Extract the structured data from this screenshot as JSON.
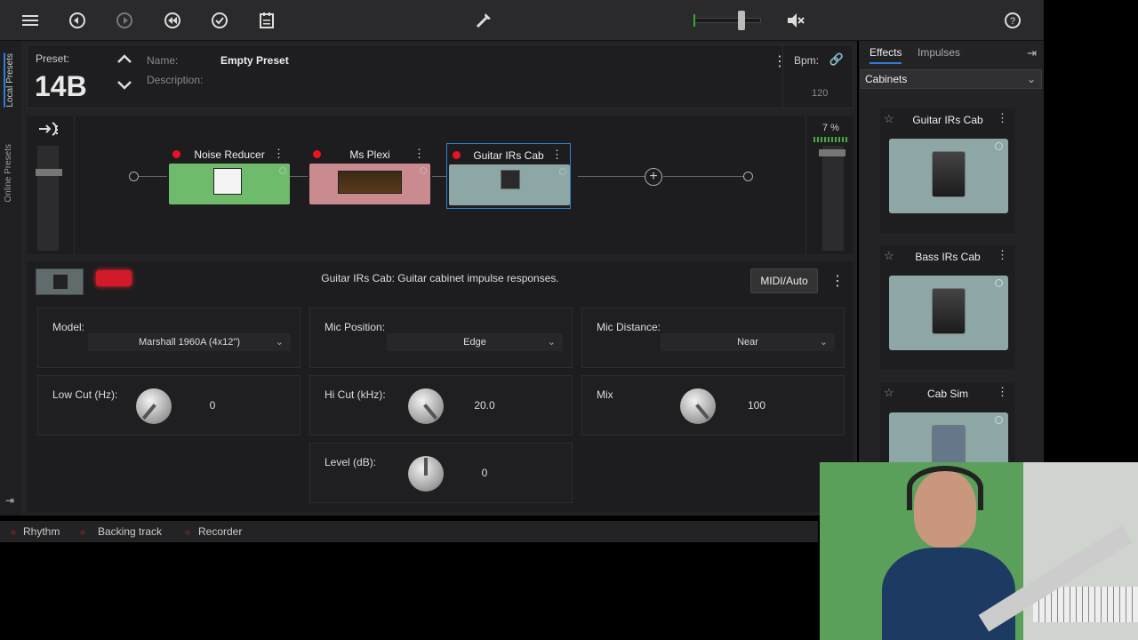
{
  "toolbar": {
    "icons": [
      "menu-icon",
      "undo-icon",
      "redo-icon",
      "revert-icon",
      "save-icon",
      "notes-icon",
      "tuner-icon",
      "mute-icon",
      "help-icon"
    ]
  },
  "left_tabs": {
    "local": "Local Presets",
    "online": "Online Presets"
  },
  "preset": {
    "label": "Preset:",
    "number": "14B",
    "name_label": "Name:",
    "name": "Empty Preset",
    "description_label": "Description:"
  },
  "bpm": {
    "label": "Bpm:",
    "value": "120"
  },
  "output": {
    "percent": "7 %"
  },
  "chain": {
    "pedals": [
      {
        "title": "Noise Reducer",
        "color": "#6fbb6c"
      },
      {
        "title": "Ms Plexi",
        "color": "#c98b8f"
      },
      {
        "title": "Guitar IRs Cab",
        "color": "#8ca7a5"
      }
    ]
  },
  "detail": {
    "description": "Guitar IRs Cab:  Guitar cabinet impulse responses.",
    "midi_button": "MIDI/Auto",
    "model_label": "Model:",
    "model_value": "Marshall 1960A (4x12\")",
    "mic_position_label": "Mic Position:",
    "mic_position_value": "Edge",
    "mic_distance_label": "Mic Distance:",
    "mic_distance_value": "Near",
    "low_cut_label": "Low Cut (Hz):",
    "low_cut_value": "0",
    "hi_cut_label": "Hi Cut (kHz):",
    "hi_cut_value": "20.0",
    "mix_label": "Mix",
    "mix_value": "100",
    "level_label": "Level (dB):",
    "level_value": "0"
  },
  "bottom": {
    "rhythm": "Rhythm",
    "backing": "Backing track",
    "recorder": "Recorder"
  },
  "right_panel": {
    "tab_effects": "Effects",
    "tab_impulses": "Impulses",
    "category": "Cabinets",
    "cards": [
      "Guitar IRs Cab",
      "Bass IRs Cab",
      "Cab Sim"
    ]
  }
}
